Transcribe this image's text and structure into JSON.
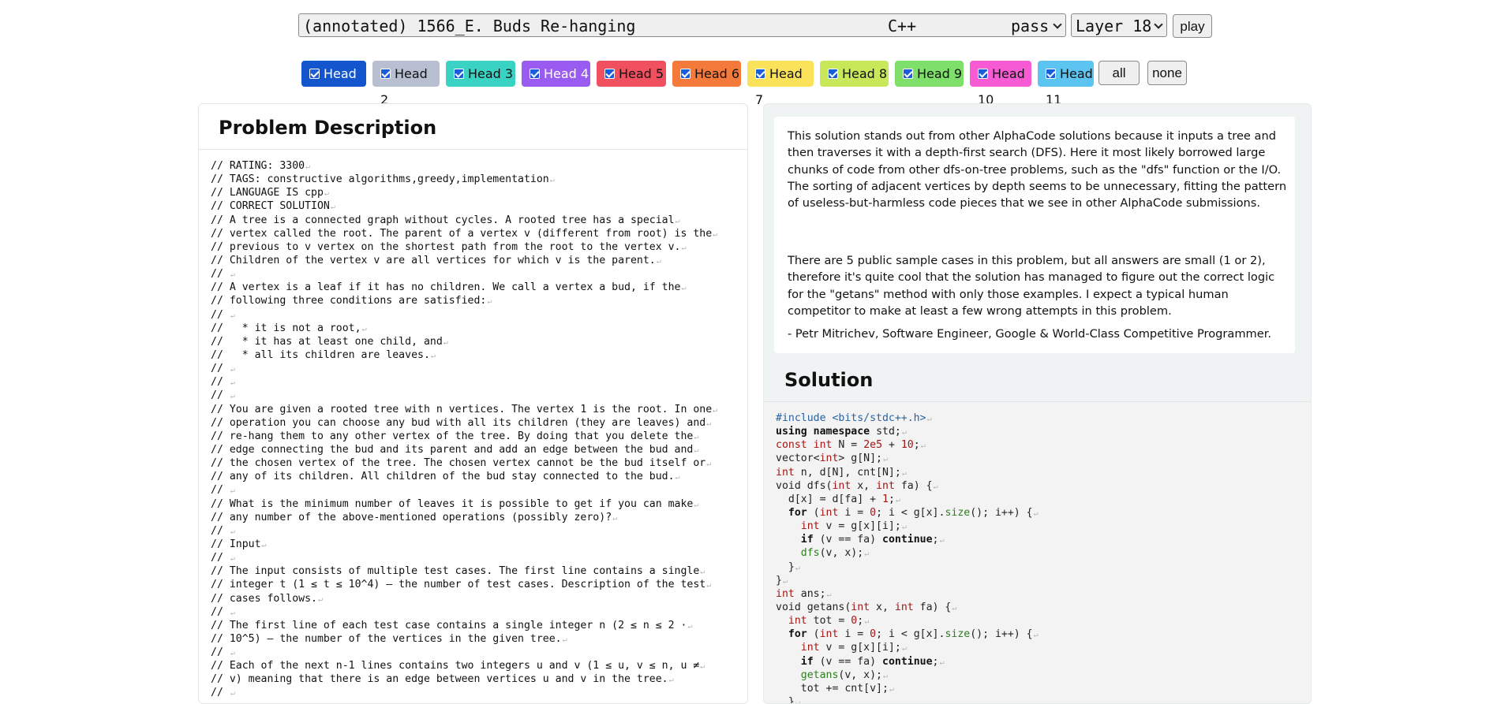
{
  "toolbar": {
    "problem_title": "(annotated) 1566_E. Buds Re-hanging",
    "problem_language": "C++",
    "problem_status": "pass",
    "layer": "Layer 18",
    "play_label": "play"
  },
  "heads": [
    {
      "label": "Head 1",
      "color": "#1255cc",
      "text_color": "#ffffff"
    },
    {
      "label": "Head 2",
      "color": "#b8bfd0",
      "text_color": "#111111"
    },
    {
      "label": "Head 3",
      "color": "#3ad3c3",
      "text_color": "#111111"
    },
    {
      "label": "Head 4",
      "color": "#9a5cf0",
      "text_color": "#ffffff"
    },
    {
      "label": "Head 5",
      "color": "#f0505f",
      "text_color": "#111111"
    },
    {
      "label": "Head 6",
      "color": "#f47a3c",
      "text_color": "#111111"
    },
    {
      "label": "Head 7",
      "color": "#fae35a",
      "text_color": "#111111"
    },
    {
      "label": "Head 8",
      "color": "#c8e85a",
      "text_color": "#111111"
    },
    {
      "label": "Head 9",
      "color": "#7ee06a",
      "text_color": "#111111"
    },
    {
      "label": "Head 10",
      "color": "#f65bd3",
      "text_color": "#111111"
    },
    {
      "label": "Head 11",
      "color": "#5cc4f0",
      "text_color": "#111111"
    }
  ],
  "head_buttons": {
    "all": "all",
    "none": "none"
  },
  "problem_panel": {
    "heading": "Problem Description",
    "lines": [
      "// RATING: 3300",
      "// TAGS: constructive algorithms,greedy,implementation",
      "// LANGUAGE IS cpp",
      "// CORRECT SOLUTION",
      "// A tree is a connected graph without cycles. A rooted tree has a special",
      "// vertex called the root. The parent of a vertex v (different from root) is the",
      "// previous to v vertex on the shortest path from the root to the vertex v.",
      "// Children of the vertex v are all vertices for which v is the parent.",
      "// ",
      "// A vertex is a leaf if it has no children. We call a vertex a bud, if the",
      "// following three conditions are satisfied:",
      "// ",
      "//   * it is not a root,",
      "//   * it has at least one child, and",
      "//   * all its children are leaves.",
      "// ",
      "// ",
      "// ",
      "// You are given a rooted tree with n vertices. The vertex 1 is the root. In one",
      "// operation you can choose any bud with all its children (they are leaves) and",
      "// re-hang them to any other vertex of the tree. By doing that you delete the",
      "// edge connecting the bud and its parent and add an edge between the bud and",
      "// the chosen vertex of the tree. The chosen vertex cannot be the bud itself or",
      "// any of its children. All children of the bud stay connected to the bud.",
      "// ",
      "// What is the minimum number of leaves it is possible to get if you can make",
      "// any number of the above-mentioned operations (possibly zero)?",
      "// ",
      "// Input",
      "// ",
      "// The input consists of multiple test cases. The first line contains a single",
      "// integer t (1 ≤ t ≤ 10^4) — the number of test cases. Description of the test",
      "// cases follows.",
      "// ",
      "// The first line of each test case contains a single integer n (2 ≤ n ≤ 2 ·",
      "// 10^5) — the number of the vertices in the given tree.",
      "// ",
      "// Each of the next n-1 lines contains two integers u and v (1 ≤ u, v ≤ n, u ≠",
      "// v) meaning that there is an edge between vertices u and v in the tree.",
      "// "
    ]
  },
  "commentary": {
    "paragraphs": [
      "This solution stands out from other AlphaCode solutions because it inputs a tree and then traverses it with a depth-first search (DFS). Here it most likely borrowed large chunks of code from other dfs-on-tree problems, such as the \"dfs\" function or the I/O. The sorting of adjacent vertices by depth seems to be unnecessary, fitting the pattern of useless-but-harmless code pieces that we see in other AlphaCode submissions.",
      "There are 5 public sample cases in this problem, but all answers are small (1 or 2), therefore it's quite cool that the solution has managed to figure out the correct logic for the \"getans\" method with only those examples. I expect a typical human competitor to make at least a few wrong attempts in this problem.",
      "- Petr Mitrichev, Software Engineer, Google & World-Class Competitive Programmer."
    ]
  },
  "solution": {
    "heading": "Solution",
    "code_lines": [
      "#include <bits/stdc++.h>",
      "using namespace std;",
      "const int N = 2e5 + 10;",
      "vector<int> g[N];",
      "int n, d[N], cnt[N];",
      "void dfs(int x, int fa) {",
      "  d[x] = d[fa] + 1;",
      "  for (int i = 0; i < g[x].size(); i++) {",
      "    int v = g[x][i];",
      "    if (v == fa) continue;",
      "    dfs(v, x);",
      "  }",
      "}",
      "int ans;",
      "void getans(int x, int fa) {",
      "  int tot = 0;",
      "  for (int i = 0; i < g[x].size(); i++) {",
      "    int v = g[x][i];",
      "    if (v == fa) continue;",
      "    getans(v, x);",
      "    tot += cnt[v];",
      "  }"
    ]
  }
}
